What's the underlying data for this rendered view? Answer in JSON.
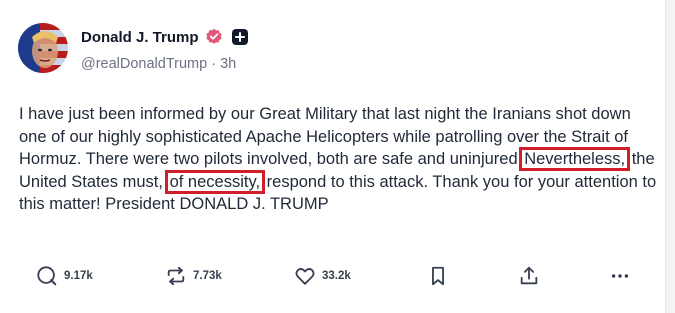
{
  "post": {
    "display_name": "Donald J. Trump",
    "handle": "@realDonaldTrump",
    "separator": "·",
    "time": "3h",
    "text_parts": {
      "p1": "I have just been informed by our Great Military that last night the Iranians shot down one of our highly sophisticated Apache Helicopters while patrolling over the Strait of Hormuz. There were two pilots involved, both are safe and uninjured.",
      "h1": "Nevertheless,",
      "p2": " the United States must, ",
      "h2": "of necessity,",
      "p3": " respond to this attack. Thank you for your attention to this matter! President DONALD J. TRUMP"
    }
  },
  "actions": {
    "replies": "9.17k",
    "reposts": "7.73k",
    "likes": "33.2k"
  },
  "icons": {
    "verified": "verified-badge-icon",
    "plus": "plus-badge-icon",
    "reply": "reply-icon",
    "repost": "repost-icon",
    "like": "heart-icon",
    "bookmark": "bookmark-icon",
    "share": "share-icon",
    "more": "more-icon"
  },
  "colors": {
    "highlight_box": "#d01f2a",
    "verified": "#e0587a",
    "text": "#1f2937",
    "muted": "#6b7280"
  }
}
